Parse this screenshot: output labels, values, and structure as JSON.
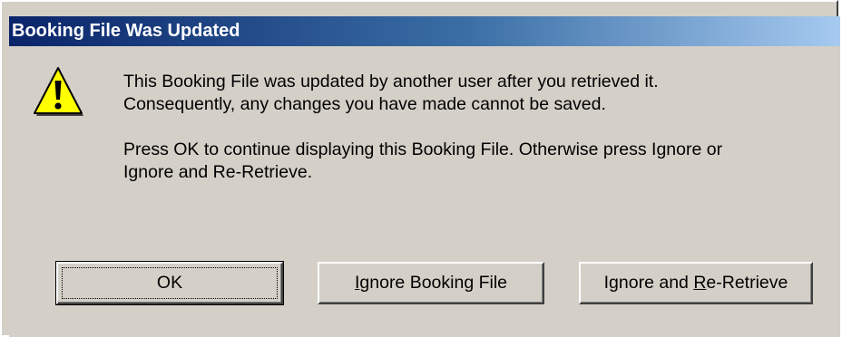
{
  "dialog": {
    "title": "Booking File Was Updated",
    "icon": "warning-icon",
    "message": {
      "line1": "This Booking File was updated by another user after you retrieved it.",
      "line2": "Consequently, any changes you have made cannot be saved.",
      "line3": "Press OK to continue displaying this Booking File.  Otherwise press Ignore or",
      "line4": "Ignore and Re-Retrieve."
    },
    "buttons": {
      "ok_label": "OK",
      "ignore_prefix": "",
      "ignore_mnemonic": "I",
      "ignore_rest": "gnore Booking File",
      "reretrieve_prefix": "Ignore and ",
      "reretrieve_mnemonic": "R",
      "reretrieve_rest": "e-Retrieve"
    }
  },
  "colors": {
    "title_gradient_start": "#0a246a",
    "title_gradient_end": "#a6caf0",
    "dialog_bg": "#d4d0c8",
    "warning_yellow": "#ffff00"
  }
}
